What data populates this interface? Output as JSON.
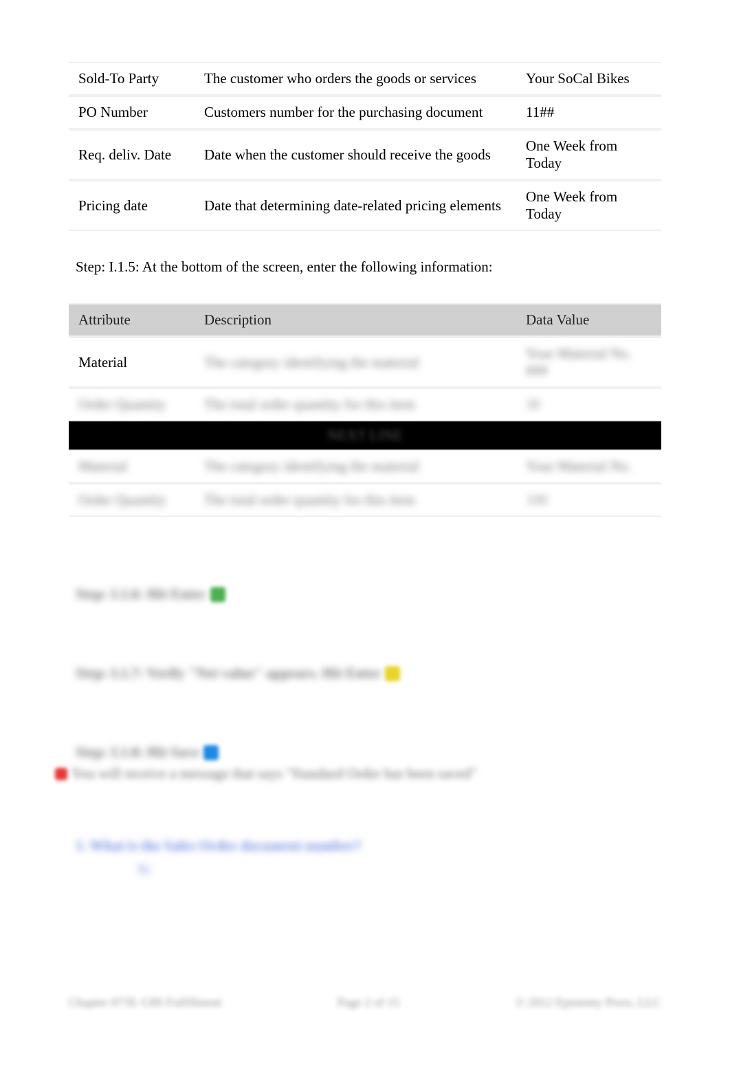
{
  "table1": {
    "rows": [
      {
        "attr": "Sold-To Party",
        "desc": "The customer who orders the goods or services",
        "val": "Your SoCal Bikes"
      },
      {
        "attr": "PO Number",
        "desc": "Customers number for the purchasing document",
        "val": "11##"
      },
      {
        "attr": "Req. deliv. Date",
        "desc": "Date when the customer should receive the goods",
        "val": "One Week from Today"
      },
      {
        "attr": "Pricing date",
        "desc": "Date that determining date-related pricing elements",
        "val": "One Week from Today"
      }
    ]
  },
  "step_line": "Step: I.1.5: At the bottom of the screen, enter the following information:",
  "table2": {
    "headers": {
      "attr": "Attribute",
      "desc": "Description",
      "val": "Data Value"
    },
    "rows": [
      {
        "attr": "Material",
        "desc": "The category identifying the material",
        "val": "Your Material No. ###"
      },
      {
        "attr": "Order Quantity",
        "desc": "The total order quantity for this item",
        "val": "30"
      }
    ],
    "banner": "NEXT LINE",
    "rows2": [
      {
        "attr": "Material",
        "desc": "The category identifying the material",
        "val": "Your Material No."
      },
      {
        "attr": "Order Quantity",
        "desc": "The total order quantity for this item",
        "val": "100"
      }
    ]
  },
  "blur_steps": {
    "s1": "Step: I.1.6: Hit Enter",
    "s2": "Step: I.1.7: Verify \"Net value\" appears. Hit Enter",
    "s3": "Step: I.1.8: Hit Save",
    "msg": "You will receive a message that says \"Standard Order has been saved\"",
    "q": "1. What is the Sales Order document number?",
    "q_sub": "N:"
  },
  "footer": {
    "left": "Chapter 07/II: GBI Fulfillment",
    "mid": "Page 2 of 15",
    "right": "© 2012 Epistemy Press, LLC"
  }
}
